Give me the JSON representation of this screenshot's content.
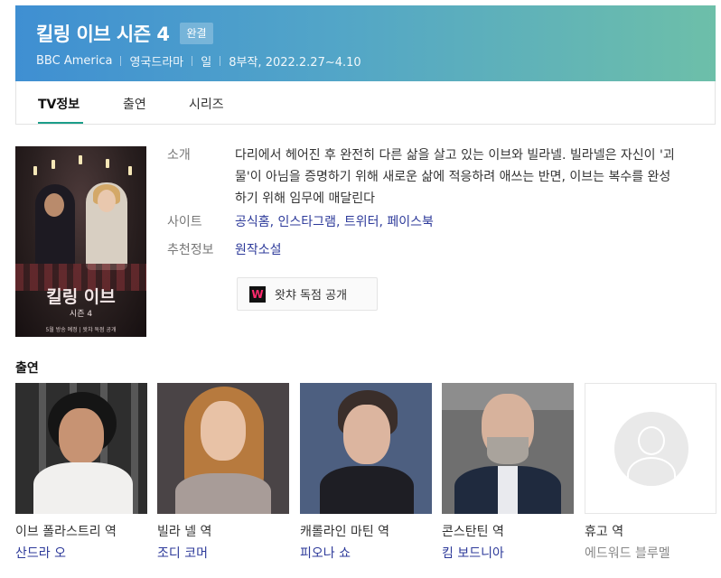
{
  "header": {
    "title": "킬링 이브 시즌 4",
    "badge": "완결",
    "meta": [
      "BBC America",
      "영국드라마",
      "일",
      "8부작, 2022.2.27~4.10"
    ]
  },
  "tabs": [
    {
      "label": "TV정보",
      "active": true
    },
    {
      "label": "출연",
      "active": false
    },
    {
      "label": "시리즈",
      "active": false
    }
  ],
  "poster": {
    "title": "킬링 이브",
    "season": "시즌 4",
    "tagline": "5월 방송 예정 | 왓챠 독점 공개"
  },
  "info": {
    "intro_label": "소개",
    "intro_text": "다리에서 헤어진 후 완전히 다른 삶을 살고 있는 이브와 빌라넬. 빌라넬은 자신이 '괴물'이 아님을 증명하기 위해 새로운 삶에 적응하려 애쓰는 반면, 이브는 복수를 완성하기 위해 임무에 매달린다",
    "site_label": "사이트",
    "sites": [
      "공식홈",
      "인스타그램",
      "트위터",
      "페이스북"
    ],
    "recommend_label": "추천정보",
    "recommend": "원작소설"
  },
  "watcha_button": {
    "logo": "W",
    "label": "왓챠 독점 공개",
    "color": "#ff2a6d"
  },
  "cast": {
    "title": "출연",
    "members": [
      {
        "role": "이브 폴라스트리 역",
        "name": "산드라 오",
        "linked": true
      },
      {
        "role": "빌라 넬 역",
        "name": "조디 코머",
        "linked": true
      },
      {
        "role": "캐롤라인 마틴 역",
        "name": "피오나 쇼",
        "linked": true
      },
      {
        "role": "콘스탄틴 역",
        "name": "킴 보드니아",
        "linked": true
      },
      {
        "role": "휴고 역",
        "name": "에드워드 블루멜",
        "linked": false
      }
    ]
  },
  "colors": {
    "accent": "#1c9e8a",
    "link": "#2d3a9a",
    "header_gradient_start": "#3f8fd2",
    "header_gradient_end": "#6dbfa9"
  }
}
